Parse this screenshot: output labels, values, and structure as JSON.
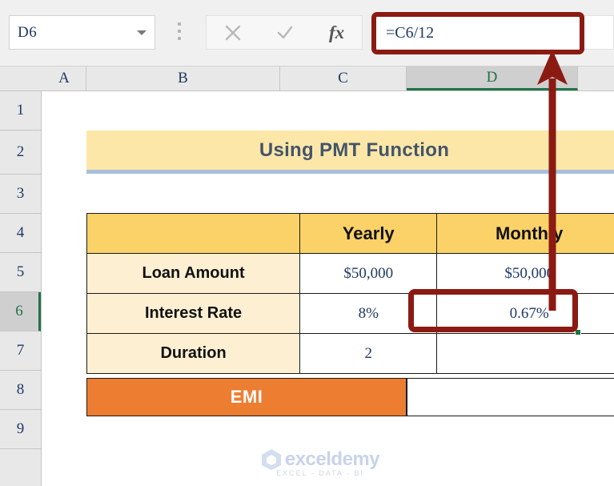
{
  "app": {
    "name_box": {
      "value": "D6",
      "caret_icon": "chevron-down-icon"
    },
    "formula_bar": {
      "cancel_icon": "close-icon",
      "confirm_icon": "check-icon",
      "function_icon": "fx-icon",
      "value": "=C6/12",
      "highlight_color": "#8B1A13"
    }
  },
  "grid": {
    "columns": [
      "A",
      "B",
      "C",
      "D"
    ],
    "active_column": "D",
    "rows": [
      "1",
      "2",
      "3",
      "4",
      "5",
      "6",
      "7",
      "8",
      "9"
    ],
    "active_row": "6",
    "active_cell": "D6",
    "selection_color": "#217346"
  },
  "sheet": {
    "title_banner": {
      "text": "Using PMT Function",
      "background": "#FCE7A8",
      "text_color": "#44546A",
      "underline_color": "#A8BEDC"
    },
    "table": {
      "header": [
        "",
        "Yearly",
        "Monthly"
      ],
      "header_background": "#FBD267",
      "label_background": "#FDF0D2",
      "rows": [
        {
          "label": "Loan Amount",
          "yearly": "$50,000",
          "monthly": "$50,000"
        },
        {
          "label": "Interest Rate",
          "yearly": "8%",
          "monthly": "0.67%"
        },
        {
          "label": "Duration",
          "yearly": "2",
          "monthly": ""
        }
      ]
    },
    "emi": {
      "label": "EMI",
      "value": "",
      "background": "#ED7D31",
      "text_color": "#FFFFFF"
    }
  },
  "annotations": {
    "color": "#8B1A13",
    "cell_highlight_target": "D6",
    "arrow": {
      "from": "D6",
      "to": "formula-bar",
      "direction": "up"
    }
  },
  "watermark": {
    "brand": "exceldemy",
    "tagline": "EXCEL - DATA - BI",
    "logo_icon": "cube-logo-icon"
  }
}
